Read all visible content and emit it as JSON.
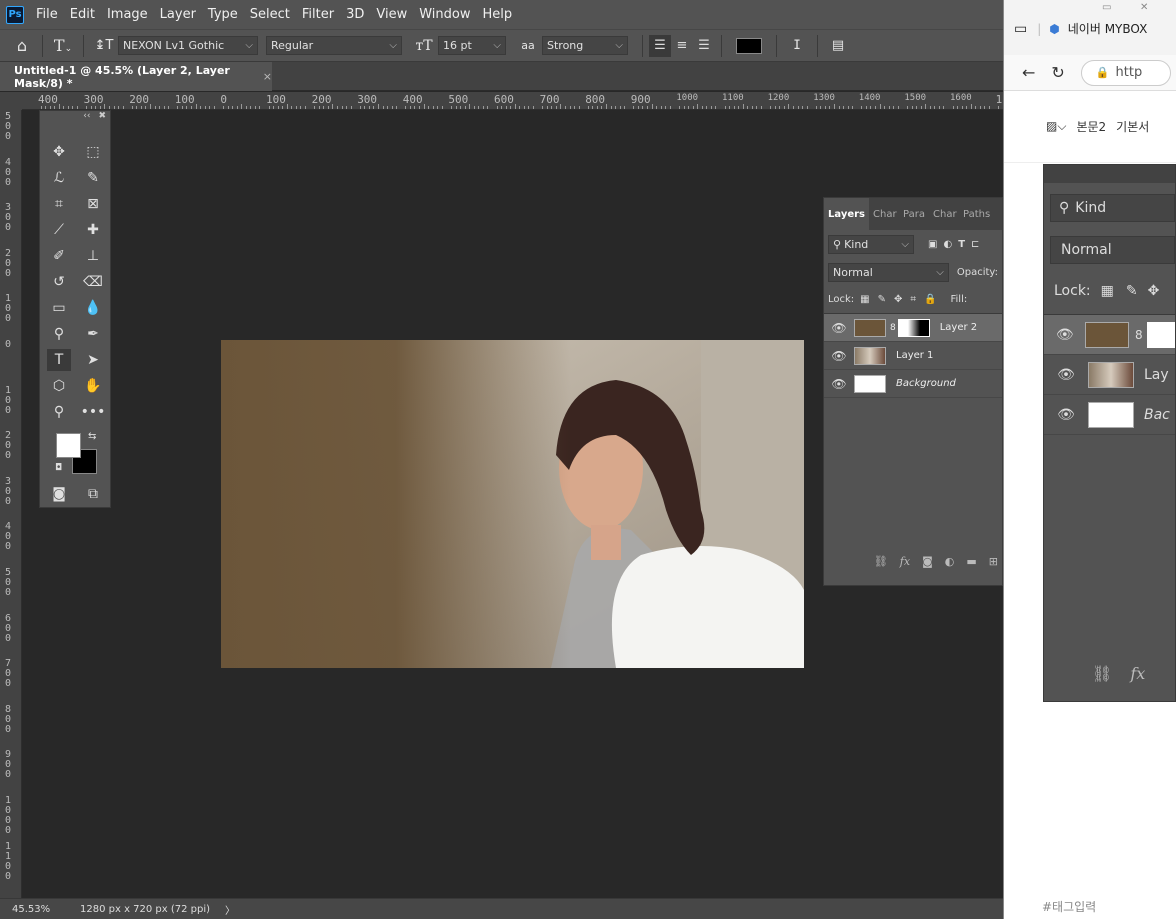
{
  "menubar": {
    "logo": "Ps",
    "items": [
      "File",
      "Edit",
      "Image",
      "Layer",
      "Type",
      "Select",
      "Filter",
      "3D",
      "View",
      "Window",
      "Help"
    ]
  },
  "options": {
    "font_family": "NEXON Lv1 Gothic",
    "font_style": "Regular",
    "font_size": "16 pt",
    "antialias": "Strong",
    "antialias_prefix": "aa",
    "text_color": "#000000"
  },
  "document_tab": {
    "title": "Untitled-1 @ 45.5% (Layer 2, Layer Mask/8) *",
    "close": "×"
  },
  "ruler": {
    "top_labels": [
      "400",
      "300",
      "200",
      "100",
      "0",
      "100",
      "200",
      "300",
      "400",
      "500",
      "600",
      "700",
      "800",
      "900",
      "1000",
      "1100",
      "1200",
      "1300",
      "1400",
      "1500",
      "1600",
      "1"
    ],
    "left_labels": [
      "500",
      "400",
      "300",
      "200",
      "100",
      "0",
      "100",
      "200",
      "300",
      "400",
      "500",
      "600",
      "700",
      "800",
      "900",
      "1000",
      "1100"
    ]
  },
  "status": {
    "zoom": "45.53%",
    "doc_info": "1280 px x 720 px (72 ppi)",
    "arrow": "〉"
  },
  "layers_panel": {
    "tabs": [
      "Layers",
      "Char",
      "Para",
      "Char",
      "Paths"
    ],
    "filter_label": "Kind",
    "blend_mode": "Normal",
    "opacity_label": "Opacity:",
    "lock_label": "Lock:",
    "fill_label": "Fill:",
    "layers": [
      {
        "name": "Layer 2",
        "selected": true,
        "italic": false
      },
      {
        "name": "Layer 1",
        "selected": false,
        "italic": false
      },
      {
        "name": "Background",
        "selected": false,
        "italic": true
      }
    ]
  },
  "browser": {
    "tab_title": "네이버 MYBOX",
    "url_partial": "http",
    "toolbar_items": [
      "본문2",
      "기본서"
    ],
    "tag_placeholder": "#태그입력"
  },
  "big_panel": {
    "filter_label": "Kind",
    "blend_mode": "Normal",
    "lock_label": "Lock:",
    "layer_partial": "Lay",
    "background_partial": "Bac"
  },
  "colors": {
    "layer2_fill": "#6b5539",
    "ui_bg": "#535353",
    "canvas_bg": "#282828"
  }
}
